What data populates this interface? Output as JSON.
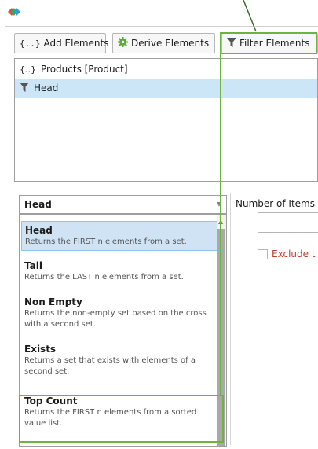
{
  "colors": {
    "accent_green": "#6cb33f",
    "selection_blue": "#cde6f7",
    "exclude_red": "#c0392b"
  },
  "toolbar": {
    "add_label": "Add Elements",
    "add_icon": "{..}",
    "derive_label": "Derive Elements",
    "filter_label": "Filter Elements"
  },
  "tree": {
    "items": [
      {
        "icon": "{..}",
        "label": "Products [Product]"
      },
      {
        "icon": "filter-icon",
        "label": "Head"
      }
    ]
  },
  "function_select": {
    "value": "Head"
  },
  "functions": [
    {
      "name": "Head",
      "desc": "Returns the FIRST n elements from a set."
    },
    {
      "name": "Tail",
      "desc": "Returns the LAST n elements from a set."
    },
    {
      "name": "Non Empty",
      "desc": "Returns the non-empty set based on the cross with a second set."
    },
    {
      "name": "Exists",
      "desc": "Returns a set that exists with elements of a second set."
    },
    {
      "name": "Top Count",
      "desc": "Returns the FIRST n elements from a sorted value list."
    }
  ],
  "params": {
    "number_label": "Number of Items",
    "exclude_label": "Exclude t"
  }
}
